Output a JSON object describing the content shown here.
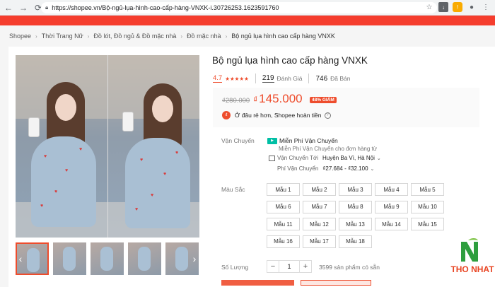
{
  "browser": {
    "url": "https://shopee.vn/Bộ-ngủ-lụa-hình-cao-cấp-hàng-VNXK-i.30726253.1623591760"
  },
  "breadcrumb": [
    "Shopee",
    "Thời Trang Nữ",
    "Đồ lót, Đồ ngủ & Đồ mặc nhà",
    "Đồ mặc nhà",
    "Bộ ngủ lụa hình cao cấp hàng VNXK"
  ],
  "product": {
    "title": "Bộ ngủ lụa hình cao cấp hàng VNXK",
    "rating": "4.7",
    "stars": "★★★★★",
    "ratings_count": "219",
    "ratings_label": "Đánh Giá",
    "sold_count": "746",
    "sold_label": "Đã Bán",
    "old_price": "₫280.000",
    "currency": "₫",
    "new_price": "145.000",
    "discount": "48% GIẢM",
    "cheap_text": "Ở đâu rẻ hơn, Shopee hoàn tiền"
  },
  "shipping": {
    "label": "Vận Chuyển",
    "free_title": "Miễn Phí Vận Chuyển",
    "free_sub": "Miễn Phí Vận Chuyển cho đơn hàng từ",
    "to_label": "Vận Chuyển Tới",
    "to_value": "Huyện Ba Vì, Hà Nội",
    "fee_label": "Phí Vận Chuyển",
    "fee_value": "₫27.684 - ₫32.100"
  },
  "color": {
    "label": "Màu Sắc",
    "options": [
      "Mẫu 1",
      "Mẫu 2",
      "Mẫu 3",
      "Mẫu 4",
      "Mẫu 5",
      "Mẫu 6",
      "Mẫu 7",
      "Mẫu 8",
      "Mẫu 9",
      "Mẫu 10",
      "Mẫu 11",
      "Mẫu 12",
      "Mẫu 13",
      "Mẫu 14",
      "Mẫu 15",
      "Mẫu 16",
      "Mẫu 17",
      "Mẫu 18"
    ]
  },
  "quantity": {
    "label": "Số Lượng",
    "value": "1",
    "minus": "−",
    "plus": "+",
    "available": "3599 sản phẩm có sẵn"
  },
  "watermark": {
    "text": "THO NHAT"
  }
}
